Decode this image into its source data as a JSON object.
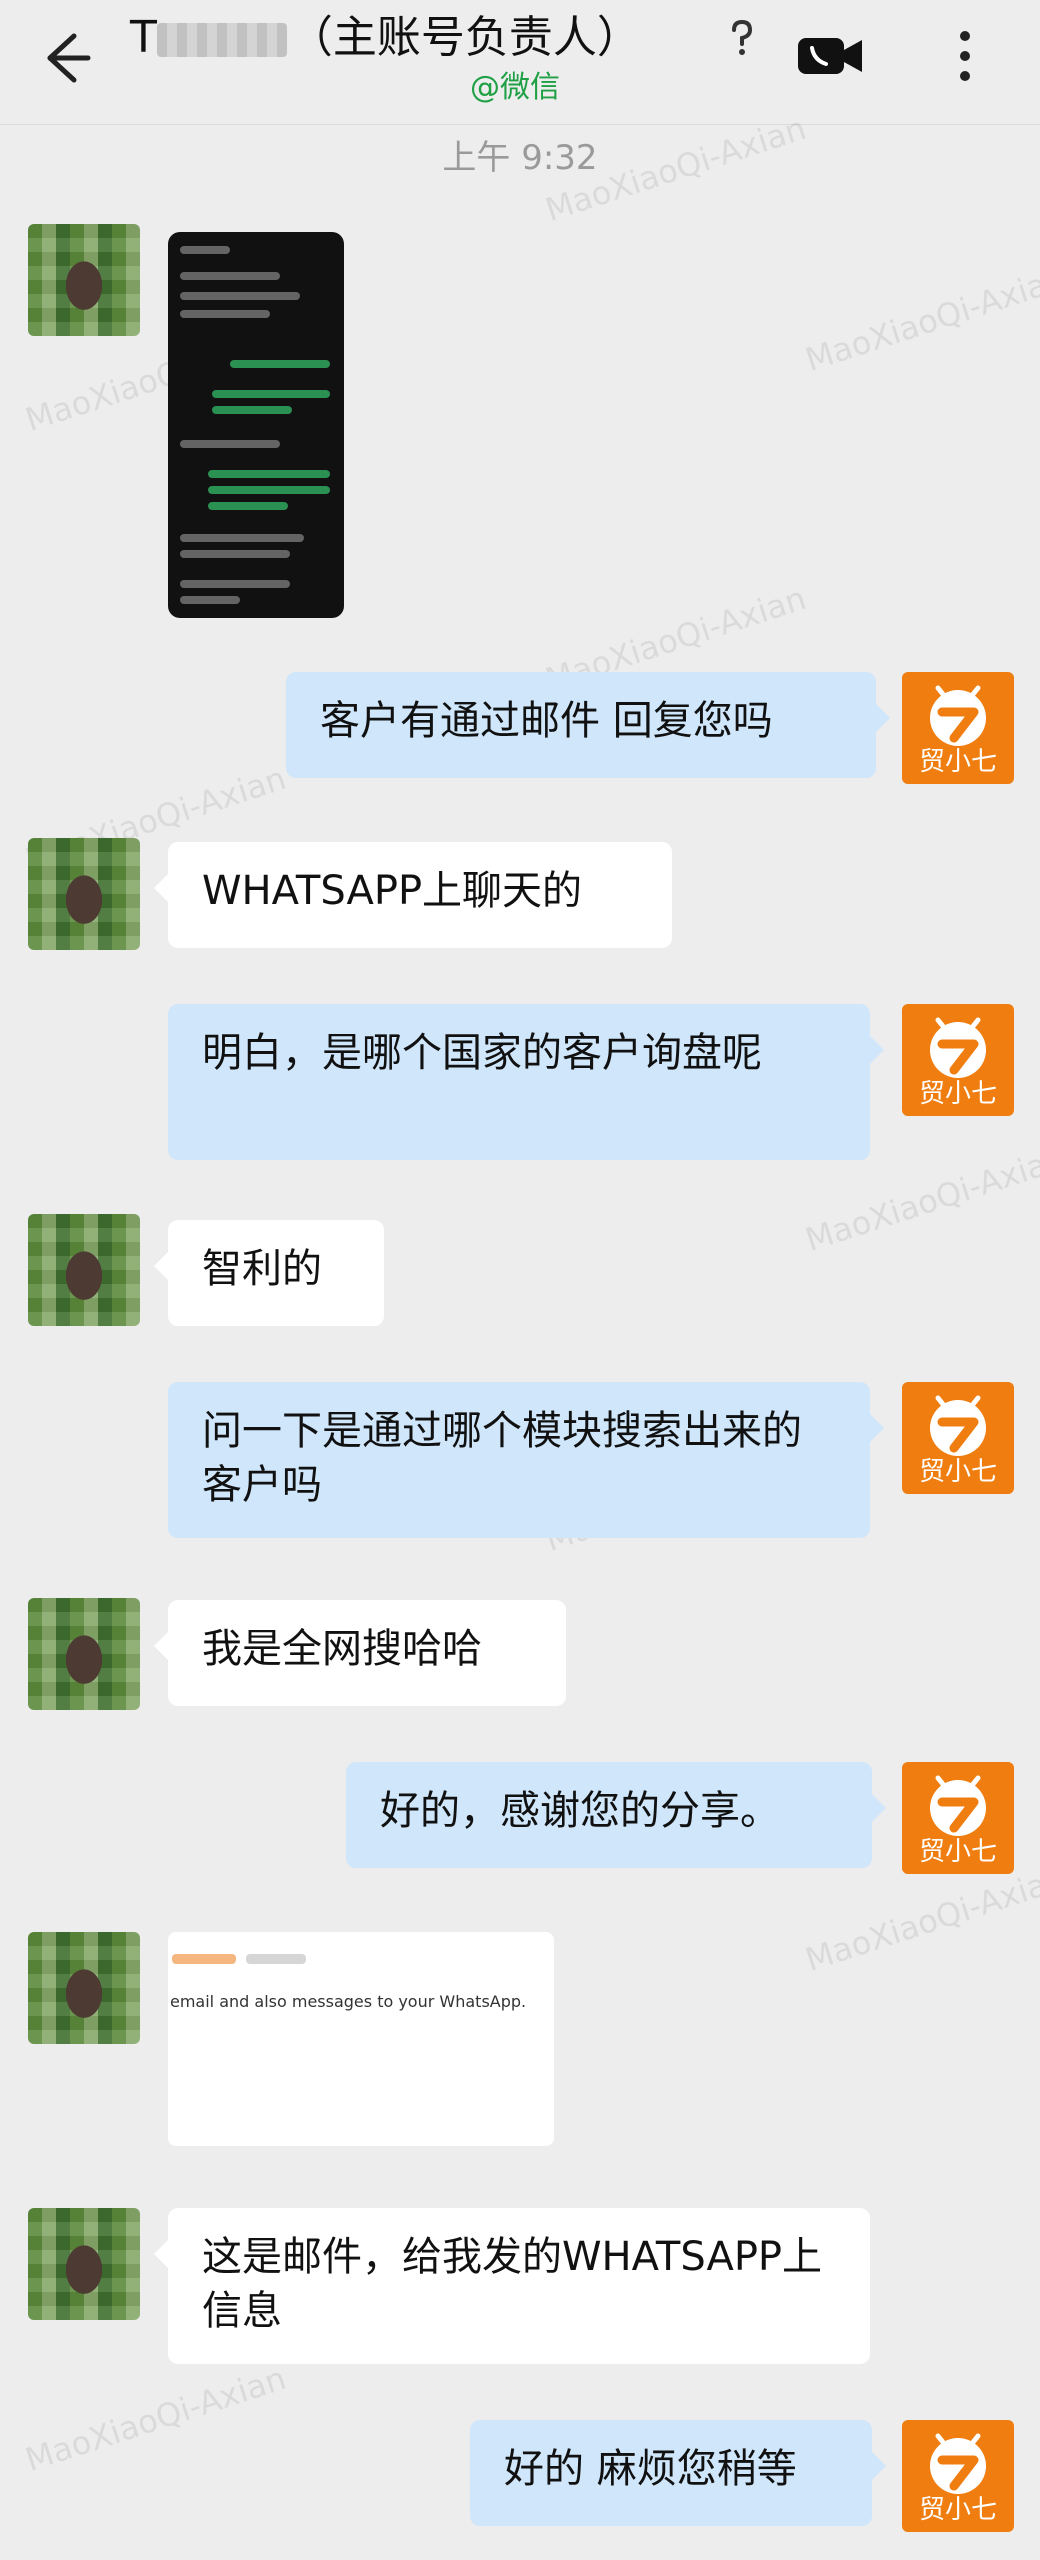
{
  "header": {
    "title_prefix": "T",
    "title_suffix": "（主账号负责人）",
    "subtitle": "@微信"
  },
  "timestamp": "上午 9:32",
  "messages": [
    {
      "side": "left",
      "type": "image",
      "name": "phone-screenshot"
    },
    {
      "side": "right",
      "type": "text",
      "text": "客户有通过邮件 回复您吗"
    },
    {
      "side": "left",
      "type": "text",
      "text": "WHATSAPP上聊天的"
    },
    {
      "side": "right",
      "type": "text",
      "text": "明白，是哪个国家的客户询盘呢"
    },
    {
      "side": "left",
      "type": "text",
      "text": "智利的"
    },
    {
      "side": "right",
      "type": "text",
      "text": "问一下是通过哪个模块搜索出来的客户吗"
    },
    {
      "side": "left",
      "type": "text",
      "text": "我是全网搜哈哈"
    },
    {
      "side": "right",
      "type": "text",
      "text": "好的，感谢您的分享。"
    },
    {
      "side": "left",
      "type": "image",
      "name": "email-screenshot",
      "caption": "email and also messages to your WhatsApp."
    },
    {
      "side": "left",
      "type": "text",
      "text": "这是邮件，给我发的WHATSAPP上信息"
    },
    {
      "side": "right",
      "type": "text",
      "text": "好的 麻烦您稍等"
    }
  ],
  "right_avatar_label": "贸小七",
  "watermark_text": "MaoXiaoQi-Axian",
  "colors": {
    "background": "#ededed",
    "sent_bubble": "#cfe6fb",
    "received_bubble": "#ffffff",
    "brand_orange": "#ef7d10",
    "subtitle_green": "#1fa045"
  }
}
